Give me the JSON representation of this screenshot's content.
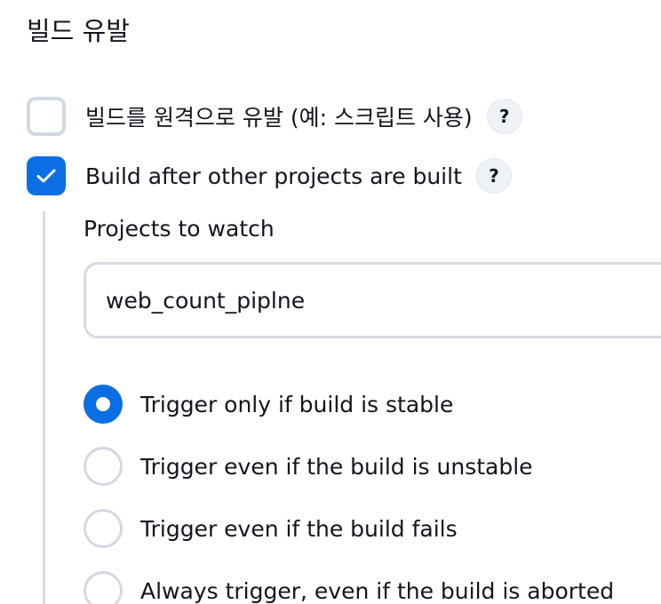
{
  "section": {
    "title": "빌드 유발"
  },
  "triggers": {
    "remote": {
      "label": "빌드를 원격으로 유발 (예: 스크립트 사용)",
      "checked": false,
      "help": "?"
    },
    "after_other": {
      "label": "Build after other projects are built",
      "checked": true,
      "help": "?"
    }
  },
  "projects_to_watch": {
    "label": "Projects to watch",
    "value": "web_count_piplne"
  },
  "trigger_options": [
    {
      "label": "Trigger only if build is stable",
      "selected": true
    },
    {
      "label": "Trigger even if the build is unstable",
      "selected": false
    },
    {
      "label": "Trigger even if the build fails",
      "selected": false
    },
    {
      "label": "Always trigger, even if the build is aborted",
      "selected": false
    }
  ],
  "colors": {
    "accent": "#0b6fe3",
    "border": "#d3d9e2"
  }
}
